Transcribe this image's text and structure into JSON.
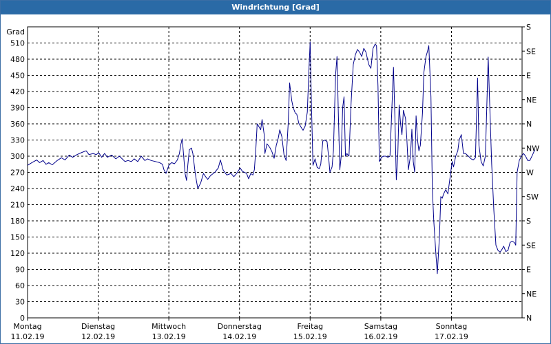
{
  "window": {
    "title": "Windrichtung [Grad]"
  },
  "chart_data": {
    "type": "line",
    "title": "Windrichtung [Grad]",
    "ylabel": "Grad",
    "xlabel": "",
    "ylim": [
      0,
      540
    ],
    "yticks": [
      0,
      30,
      60,
      90,
      120,
      150,
      180,
      210,
      240,
      270,
      300,
      330,
      360,
      390,
      420,
      450,
      480,
      510
    ],
    "y2_ticks": [
      {
        "value": 0,
        "label": "N"
      },
      {
        "value": 45,
        "label": "NE"
      },
      {
        "value": 90,
        "label": "E"
      },
      {
        "value": 135,
        "label": "SE"
      },
      {
        "value": 180,
        "label": "S"
      },
      {
        "value": 225,
        "label": "SW"
      },
      {
        "value": 270,
        "label": "W"
      },
      {
        "value": 315,
        "label": "NW"
      },
      {
        "value": 360,
        "label": "N"
      },
      {
        "value": 405,
        "label": "NE"
      },
      {
        "value": 450,
        "label": "E"
      },
      {
        "value": 495,
        "label": "SE"
      },
      {
        "value": 540,
        "label": "S"
      }
    ],
    "xlim": [
      0,
      7
    ],
    "x_categories": [
      {
        "day": "Montag",
        "date": "11.02.19"
      },
      {
        "day": "Dienstag",
        "date": "12.02.19"
      },
      {
        "day": "Mittwoch",
        "date": "13.02.19"
      },
      {
        "day": "Donnerstag",
        "date": "14.02.19"
      },
      {
        "day": "Freitag",
        "date": "15.02.19"
      },
      {
        "day": "Samstag",
        "date": "16.02.19"
      },
      {
        "day": "Sonntag",
        "date": "17.02.19"
      }
    ],
    "grid": true,
    "series": [
      {
        "color": "#00008b",
        "points": [
          [
            0.0,
            283
          ],
          [
            0.06,
            288
          ],
          [
            0.13,
            293
          ],
          [
            0.17,
            288
          ],
          [
            0.22,
            292
          ],
          [
            0.26,
            285
          ],
          [
            0.3,
            288
          ],
          [
            0.35,
            284
          ],
          [
            0.42,
            292
          ],
          [
            0.48,
            297
          ],
          [
            0.53,
            293
          ],
          [
            0.59,
            302
          ],
          [
            0.64,
            298
          ],
          [
            0.7,
            303
          ],
          [
            0.77,
            307
          ],
          [
            0.83,
            310
          ],
          [
            0.87,
            303
          ],
          [
            0.93,
            305
          ],
          [
            0.97,
            303
          ],
          [
            1.01,
            306
          ],
          [
            1.05,
            298
          ],
          [
            1.09,
            305
          ],
          [
            1.13,
            298
          ],
          [
            1.19,
            302
          ],
          [
            1.25,
            295
          ],
          [
            1.3,
            300
          ],
          [
            1.34,
            295
          ],
          [
            1.38,
            290
          ],
          [
            1.42,
            292
          ],
          [
            1.47,
            290
          ],
          [
            1.51,
            295
          ],
          [
            1.56,
            290
          ],
          [
            1.61,
            300
          ],
          [
            1.66,
            292
          ],
          [
            1.7,
            295
          ],
          [
            1.75,
            292
          ],
          [
            1.81,
            290
          ],
          [
            1.87,
            288
          ],
          [
            1.91,
            285
          ],
          [
            1.93,
            275
          ],
          [
            1.96,
            268
          ],
          [
            2.0,
            283
          ],
          [
            2.04,
            288
          ],
          [
            2.08,
            286
          ],
          [
            2.12,
            293
          ],
          [
            2.15,
            305
          ],
          [
            2.17,
            322
          ],
          [
            2.19,
            332
          ],
          [
            2.21,
            300
          ],
          [
            2.23,
            268
          ],
          [
            2.25,
            255
          ],
          [
            2.27,
            285
          ],
          [
            2.29,
            312
          ],
          [
            2.32,
            315
          ],
          [
            2.34,
            305
          ],
          [
            2.37,
            272
          ],
          [
            2.39,
            255
          ],
          [
            2.41,
            240
          ],
          [
            2.45,
            250
          ],
          [
            2.49,
            268
          ],
          [
            2.52,
            262
          ],
          [
            2.55,
            257
          ],
          [
            2.59,
            264
          ],
          [
            2.65,
            270
          ],
          [
            2.7,
            278
          ],
          [
            2.73,
            293
          ],
          [
            2.77,
            274
          ],
          [
            2.82,
            265
          ],
          [
            2.88,
            268
          ],
          [
            2.92,
            262
          ],
          [
            2.96,
            268
          ],
          [
            3.01,
            278
          ],
          [
            3.04,
            272
          ],
          [
            3.07,
            270
          ],
          [
            3.1,
            268
          ],
          [
            3.13,
            258
          ],
          [
            3.16,
            268
          ],
          [
            3.19,
            265
          ],
          [
            3.21,
            275
          ],
          [
            3.23,
            310
          ],
          [
            3.25,
            360
          ],
          [
            3.27,
            356
          ],
          [
            3.3,
            349
          ],
          [
            3.32,
            368
          ],
          [
            3.35,
            340
          ],
          [
            3.36,
            305
          ],
          [
            3.39,
            323
          ],
          [
            3.43,
            316
          ],
          [
            3.46,
            308
          ],
          [
            3.49,
            296
          ],
          [
            3.52,
            320
          ],
          [
            3.55,
            334
          ],
          [
            3.57,
            349
          ],
          [
            3.6,
            336
          ],
          [
            3.63,
            303
          ],
          [
            3.66,
            292
          ],
          [
            3.69,
            362
          ],
          [
            3.71,
            436
          ],
          [
            3.74,
            403
          ],
          [
            3.76,
            390
          ],
          [
            3.79,
            380
          ],
          [
            3.81,
            378
          ],
          [
            3.84,
            361
          ],
          [
            3.87,
            354
          ],
          [
            3.9,
            348
          ],
          [
            3.93,
            356
          ],
          [
            3.96,
            382
          ],
          [
            3.98,
            450
          ],
          [
            4.0,
            512
          ],
          [
            4.02,
            390
          ],
          [
            4.04,
            283
          ],
          [
            4.07,
            295
          ],
          [
            4.1,
            279
          ],
          [
            4.13,
            277
          ],
          [
            4.15,
            285
          ],
          [
            4.18,
            328
          ],
          [
            4.21,
            330
          ],
          [
            4.24,
            327
          ],
          [
            4.26,
            300
          ],
          [
            4.28,
            270
          ],
          [
            4.31,
            280
          ],
          [
            4.33,
            310
          ],
          [
            4.36,
            450
          ],
          [
            4.38,
            485
          ],
          [
            4.4,
            376
          ],
          [
            4.42,
            275
          ],
          [
            4.44,
            300
          ],
          [
            4.46,
            390
          ],
          [
            4.48,
            410
          ],
          [
            4.5,
            300
          ],
          [
            4.52,
            305
          ],
          [
            4.55,
            300
          ],
          [
            4.58,
            400
          ],
          [
            4.61,
            470
          ],
          [
            4.64,
            488
          ],
          [
            4.67,
            498
          ],
          [
            4.7,
            493
          ],
          [
            4.73,
            485
          ],
          [
            4.76,
            500
          ],
          [
            4.79,
            493
          ],
          [
            4.83,
            470
          ],
          [
            4.86,
            463
          ],
          [
            4.89,
            500
          ],
          [
            4.92,
            508
          ],
          [
            4.94,
            505
          ],
          [
            4.96,
            430
          ],
          [
            4.98,
            290
          ],
          [
            5.01,
            298
          ],
          [
            5.04,
            300
          ],
          [
            5.07,
            300
          ],
          [
            5.1,
            298
          ],
          [
            5.13,
            300
          ],
          [
            5.16,
            400
          ],
          [
            5.18,
            465
          ],
          [
            5.2,
            370
          ],
          [
            5.22,
            256
          ],
          [
            5.24,
            300
          ],
          [
            5.26,
            395
          ],
          [
            5.28,
            360
          ],
          [
            5.3,
            340
          ],
          [
            5.32,
            385
          ],
          [
            5.35,
            370
          ],
          [
            5.37,
            330
          ],
          [
            5.39,
            275
          ],
          [
            5.42,
            300
          ],
          [
            5.44,
            350
          ],
          [
            5.46,
            290
          ],
          [
            5.48,
            270
          ],
          [
            5.5,
            375
          ],
          [
            5.52,
            330
          ],
          [
            5.54,
            310
          ],
          [
            5.56,
            320
          ],
          [
            5.59,
            380
          ],
          [
            5.61,
            455
          ],
          [
            5.64,
            485
          ],
          [
            5.66,
            494
          ],
          [
            5.68,
            505
          ],
          [
            5.71,
            410
          ],
          [
            5.73,
            240
          ],
          [
            5.75,
            180
          ],
          [
            5.78,
            118
          ],
          [
            5.8,
            82
          ],
          [
            5.83,
            150
          ],
          [
            5.85,
            225
          ],
          [
            5.87,
            222
          ],
          [
            5.89,
            230
          ],
          [
            5.92,
            238
          ],
          [
            5.95,
            230
          ],
          [
            5.98,
            260
          ],
          [
            6.01,
            290
          ],
          [
            6.03,
            280
          ],
          [
            6.06,
            300
          ],
          [
            6.09,
            310
          ],
          [
            6.11,
            330
          ],
          [
            6.14,
            340
          ],
          [
            6.17,
            305
          ],
          [
            6.2,
            305
          ],
          [
            6.24,
            300
          ],
          [
            6.28,
            295
          ],
          [
            6.31,
            293
          ],
          [
            6.34,
            297
          ],
          [
            6.37,
            445
          ],
          [
            6.39,
            320
          ],
          [
            6.42,
            290
          ],
          [
            6.45,
            282
          ],
          [
            6.48,
            300
          ],
          [
            6.5,
            388
          ],
          [
            6.52,
            484
          ],
          [
            6.55,
            365
          ],
          [
            6.57,
            285
          ],
          [
            6.6,
            200
          ],
          [
            6.63,
            135
          ],
          [
            6.66,
            125
          ],
          [
            6.69,
            122
          ],
          [
            6.72,
            128
          ],
          [
            6.74,
            133
          ],
          [
            6.77,
            123
          ],
          [
            6.8,
            125
          ],
          [
            6.83,
            140
          ],
          [
            6.86,
            142
          ],
          [
            6.89,
            140
          ],
          [
            6.91,
            135
          ],
          [
            6.93,
            270
          ],
          [
            6.96,
            292
          ],
          [
            6.99,
            300
          ],
          [
            7.02,
            305
          ],
          [
            7.05,
            300
          ],
          [
            7.08,
            292
          ],
          [
            7.11,
            292
          ],
          [
            7.15,
            303
          ],
          [
            7.18,
            312
          ]
        ]
      }
    ]
  }
}
